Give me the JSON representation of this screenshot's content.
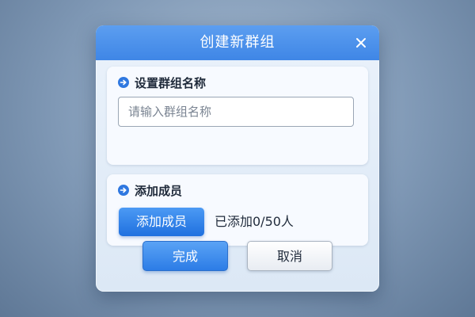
{
  "dialog": {
    "title": "创建新群组",
    "close_icon": "close-icon"
  },
  "group_name": {
    "section_title": "设置群组名称",
    "section_icon": "arrow-right-circle-icon",
    "input_value": "",
    "input_placeholder": "请输入群组名称"
  },
  "members": {
    "section_title": "添加成员",
    "section_icon": "arrow-right-circle-icon",
    "add_button_label": "添加成员",
    "count_text": "已添加0/50人"
  },
  "footer": {
    "ok_label": "完成",
    "cancel_label": "取消"
  },
  "colors": {
    "titlebar": "#3f86e6",
    "primary_button": "#1f70df",
    "accent_icon": "#2f78e0"
  }
}
